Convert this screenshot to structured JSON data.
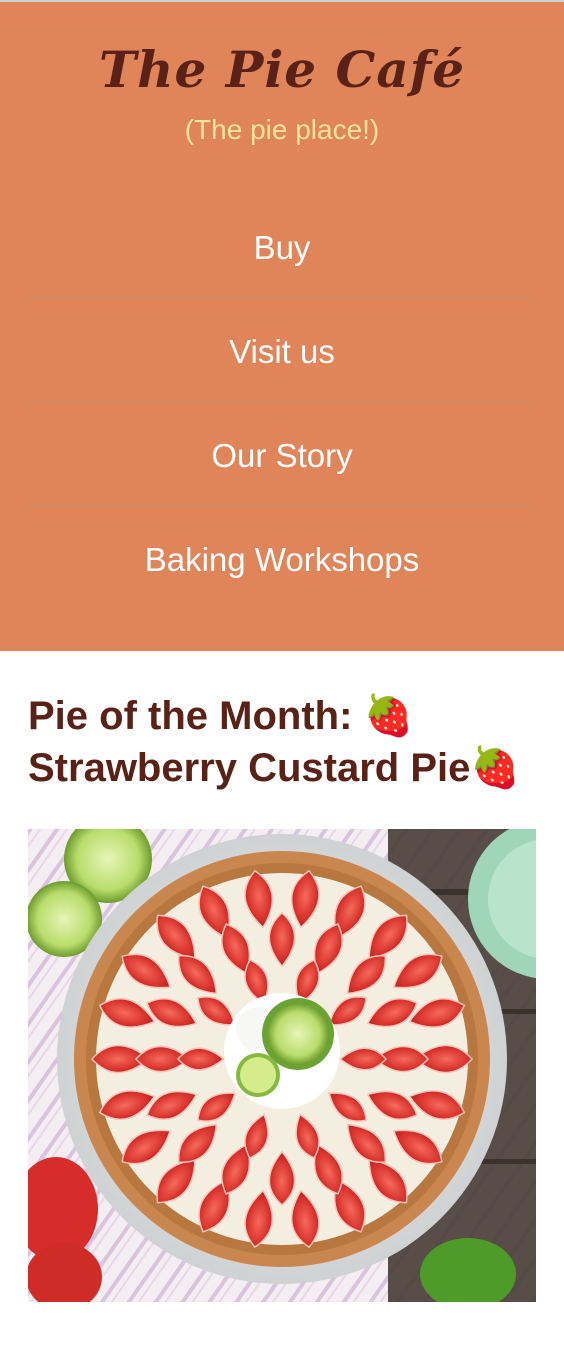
{
  "header": {
    "title": "The Pie Café",
    "tagline": "(The pie place!)",
    "background_color": "#e0845a"
  },
  "nav": {
    "items": [
      {
        "label": "Buy"
      },
      {
        "label": "Visit us"
      },
      {
        "label": "Our Story"
      },
      {
        "label": "Baking Workshops"
      }
    ]
  },
  "main": {
    "heading": "Pie of the Month: 🍓 Strawberry Custard Pie🍓",
    "image": {
      "subject": "strawberry-custard-pie-photo"
    }
  }
}
